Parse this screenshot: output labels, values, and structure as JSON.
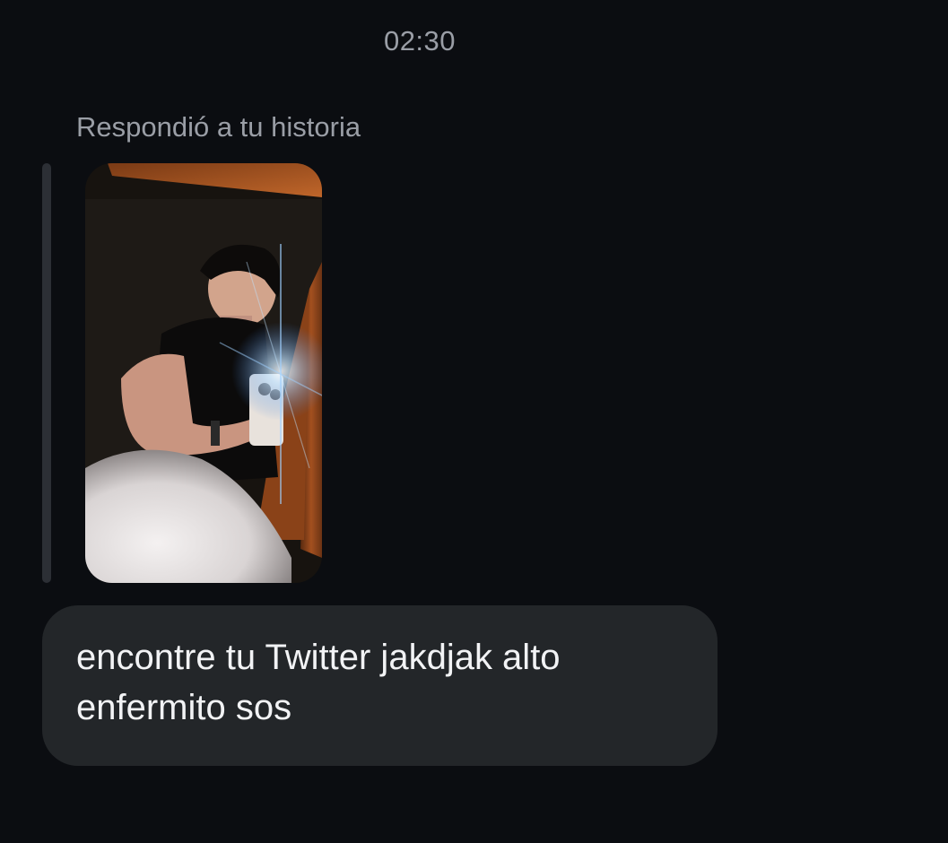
{
  "chat": {
    "timestamp": "02:30",
    "reply_label": "Respondió a tu historia",
    "story_thumbnail_icon": "story-photo-icon",
    "message_text": "encontre tu Twitter jakdjak alto enfermito sos",
    "colors": {
      "background": "#0b0d11",
      "bubble": "#232629",
      "meta_text": "#9a9ea6",
      "message_text": "#f2f3f5"
    }
  }
}
